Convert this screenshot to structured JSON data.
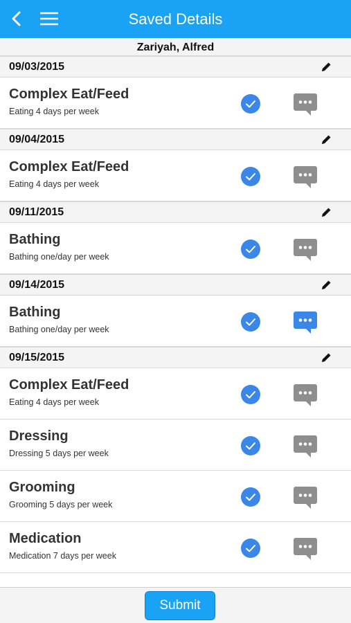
{
  "header": {
    "title": "Saved Details",
    "back_icon": "chevron-left-icon",
    "menu_icon": "hamburger-menu-icon",
    "color": "#1aa3f5"
  },
  "patient_name": "Zariyah, Alfred",
  "groups": [
    {
      "date": "09/03/2015",
      "items": [
        {
          "title": "Complex Eat/Feed",
          "description": "Eating 4 days per week",
          "checked": true,
          "has_comment": false
        }
      ]
    },
    {
      "date": "09/04/2015",
      "items": [
        {
          "title": "Complex Eat/Feed",
          "description": "Eating 4 days per week",
          "checked": true,
          "has_comment": false
        }
      ]
    },
    {
      "date": "09/11/2015",
      "items": [
        {
          "title": "Bathing",
          "description": "Bathing one/day per week",
          "checked": true,
          "has_comment": false
        }
      ]
    },
    {
      "date": "09/14/2015",
      "items": [
        {
          "title": "Bathing",
          "description": "Bathing one/day per week",
          "checked": true,
          "has_comment": true
        }
      ]
    },
    {
      "date": "09/15/2015",
      "items": [
        {
          "title": "Complex Eat/Feed",
          "description": "Eating 4 days per week",
          "checked": true,
          "has_comment": false
        },
        {
          "title": "Dressing",
          "description": "Dressing 5 days per week",
          "checked": true,
          "has_comment": false
        },
        {
          "title": "Grooming",
          "description": "Grooming 5 days per week",
          "checked": true,
          "has_comment": false
        },
        {
          "title": "Medication",
          "description": "Medication 7 days per week",
          "checked": true,
          "has_comment": false
        }
      ]
    }
  ],
  "footer": {
    "submit_label": "Submit"
  },
  "colors": {
    "check": "#3a87e8",
    "comment_inactive": "#8e8e8e",
    "comment_active": "#3a87e8"
  },
  "icons": {
    "edit": "pencil-icon",
    "check": "check-circle-icon",
    "comment": "speech-bubble-icon"
  }
}
